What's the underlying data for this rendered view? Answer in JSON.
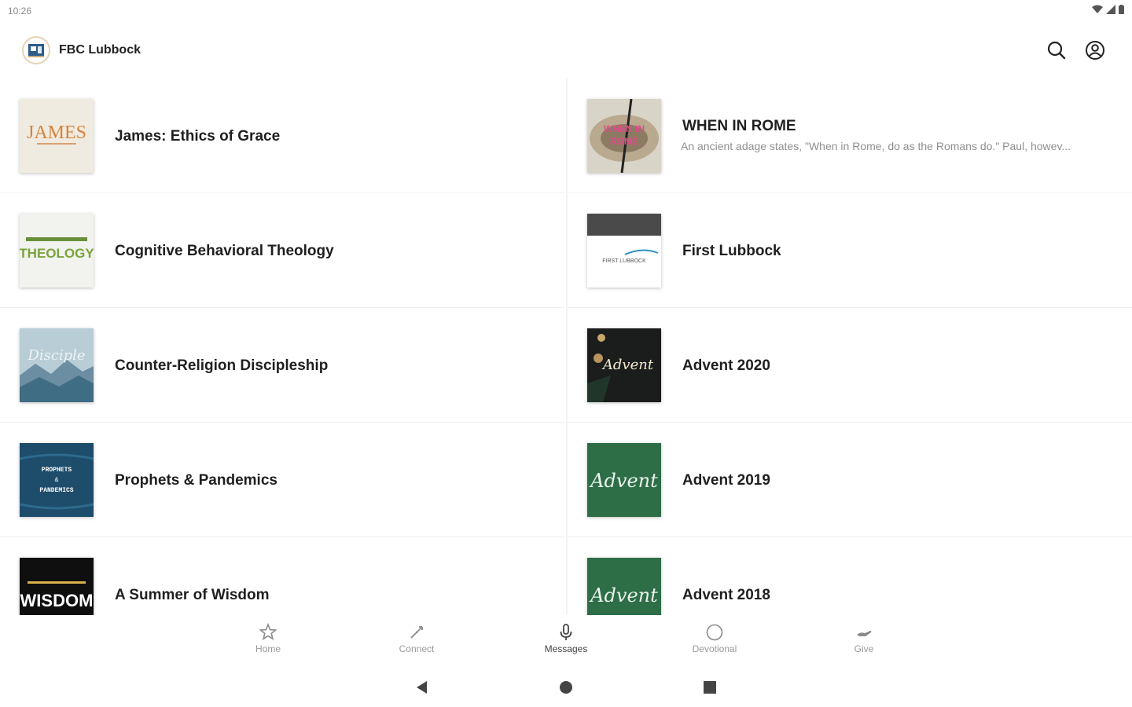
{
  "status": {
    "time": "10:26"
  },
  "header": {
    "title": "FBC Lubbock"
  },
  "series_left": [
    {
      "title": "James: Ethics of Grace",
      "art": "JAMES"
    },
    {
      "title": "Cognitive Behavioral Theology",
      "art": "THEOLOGY"
    },
    {
      "title": "Counter-Religion Discipleship",
      "art": "Disciple"
    },
    {
      "title": "Prophets & Pandemics",
      "art": "PROPHETS & PANDEMICS"
    },
    {
      "title": "A Summer of Wisdom",
      "art": "WISDOM"
    }
  ],
  "series_right": [
    {
      "title": "WHEN IN ROME",
      "subtitle": "An ancient adage states, \"When in Rome, do as the Romans do.\" Paul, howev...",
      "art": "WHEN IN ROME"
    },
    {
      "title": "First Lubbock",
      "art": "FIRST LUBBOCK"
    },
    {
      "title": "Advent 2020",
      "art": "Advent"
    },
    {
      "title": "Advent 2019",
      "art": "Advent"
    },
    {
      "title": "Advent 2018",
      "art": "Advent"
    }
  ],
  "nav": [
    {
      "label": "Home",
      "icon": "star-icon"
    },
    {
      "label": "Connect",
      "icon": "connect-icon"
    },
    {
      "label": "Messages",
      "icon": "microphone-icon"
    },
    {
      "label": "Devotional",
      "icon": "circle-icon"
    },
    {
      "label": "Give",
      "icon": "give-icon"
    }
  ],
  "colors": {
    "james_bg": "#f0ebe1",
    "james_text": "#d8823a",
    "advent_green": "#2e6e47",
    "prophets_blue": "#1e4c6b",
    "advent2020_bg": "#1b1d1c"
  }
}
